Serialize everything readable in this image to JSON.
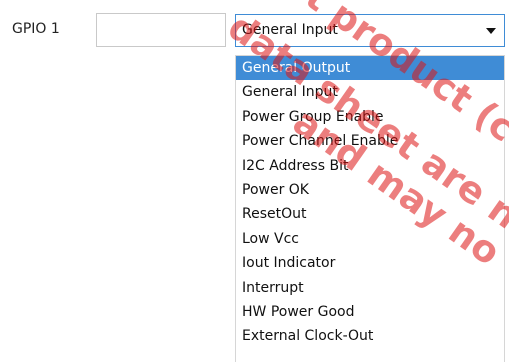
{
  "form": {
    "gpio_label": "GPIO 1",
    "text_field_value": "",
    "select_value": "General Input"
  },
  "dropdown": {
    "options": [
      "General Output",
      "General Input",
      "Power Group Enable",
      "Power Channel Enable",
      "I2C Address Bit",
      "Power OK",
      "ResetOut",
      "Low Vcc",
      "Iout Indicator",
      "Interrupt",
      "HW Power Good",
      "External Clock-Out"
    ],
    "highlighted_index": 0
  },
  "watermark": {
    "line1": "not product (c",
    "line2": "data sheet are not",
    "line3": "and may no",
    "color": "#dc1414"
  },
  "colors": {
    "highlight": "#3f8cd6"
  }
}
